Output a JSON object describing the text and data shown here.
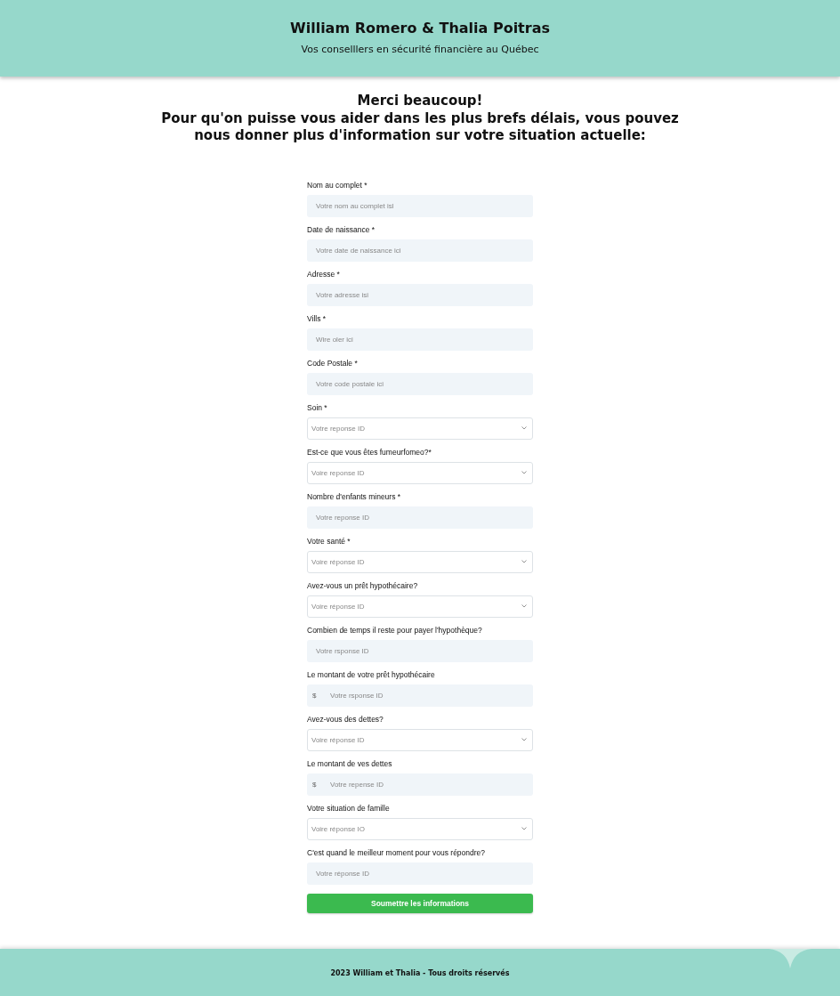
{
  "header": {
    "title": "William Romero & Thalia Poitras",
    "subtitle": "Vos conselllers en sécurité financière au Québec"
  },
  "intro": [
    "Merci beaucoup!",
    "Pour qu'on puisse vous aider dans les plus brefs délais, vous pouvez nous donner plus d'information sur votre situation actuelle:"
  ],
  "form": {
    "fields": [
      {
        "kind": "text",
        "label": "Nom au complet *",
        "placeholder": "Votre nom au complet isl"
      },
      {
        "kind": "text",
        "label": "Date de naissance *",
        "placeholder": "Votre date de naissance ici"
      },
      {
        "kind": "text",
        "label": "Adresse *",
        "placeholder": "Votre adresse isi"
      },
      {
        "kind": "text",
        "label": "Vills *",
        "placeholder": "Wire oler ici"
      },
      {
        "kind": "text",
        "label": "Code Postale *",
        "placeholder": "Votre code postale ici"
      },
      {
        "kind": "select",
        "label": "Soin *",
        "placeholder": "Votre reponse ID"
      },
      {
        "kind": "select",
        "label": "Est-ce que vous êtes fumeurfomeo?*",
        "placeholder": "Voire reponse ID"
      },
      {
        "kind": "text",
        "label": "Nombre d'enfants mineurs *",
        "placeholder": "Votre reponse ID"
      },
      {
        "kind": "select",
        "label": "Votre santé *",
        "placeholder": "Voire réponse ID"
      },
      {
        "kind": "select",
        "label": "Avez-vous un prêt hypothécaire?",
        "placeholder": "Voire réponse ID"
      },
      {
        "kind": "text",
        "label": "Combien de temps il reste pour payer l'hypothèque?",
        "placeholder": "Votre rsponse ID"
      },
      {
        "kind": "currency",
        "label": "Le montant de votre prêt hypothécaire",
        "currency": "$",
        "placeholder": "Votre rsponse ID"
      },
      {
        "kind": "select",
        "label": "Avez-vous des dettes?",
        "placeholder": "Voire réponse ID"
      },
      {
        "kind": "currency",
        "label": "Le montant de ves dettes",
        "currency": "$",
        "placeholder": "Votre repense ID"
      },
      {
        "kind": "select",
        "label": "Votre situation de famille",
        "placeholder": "Voire réponse IO"
      },
      {
        "kind": "text",
        "label": "C'est quand le meilleur moment pour vous répondre?",
        "placeholder": "Votre réponse ID"
      }
    ],
    "submit": "Soumettre les informations"
  },
  "footer": {
    "text": "2023 William et Thalia - Tous droits réservés"
  }
}
